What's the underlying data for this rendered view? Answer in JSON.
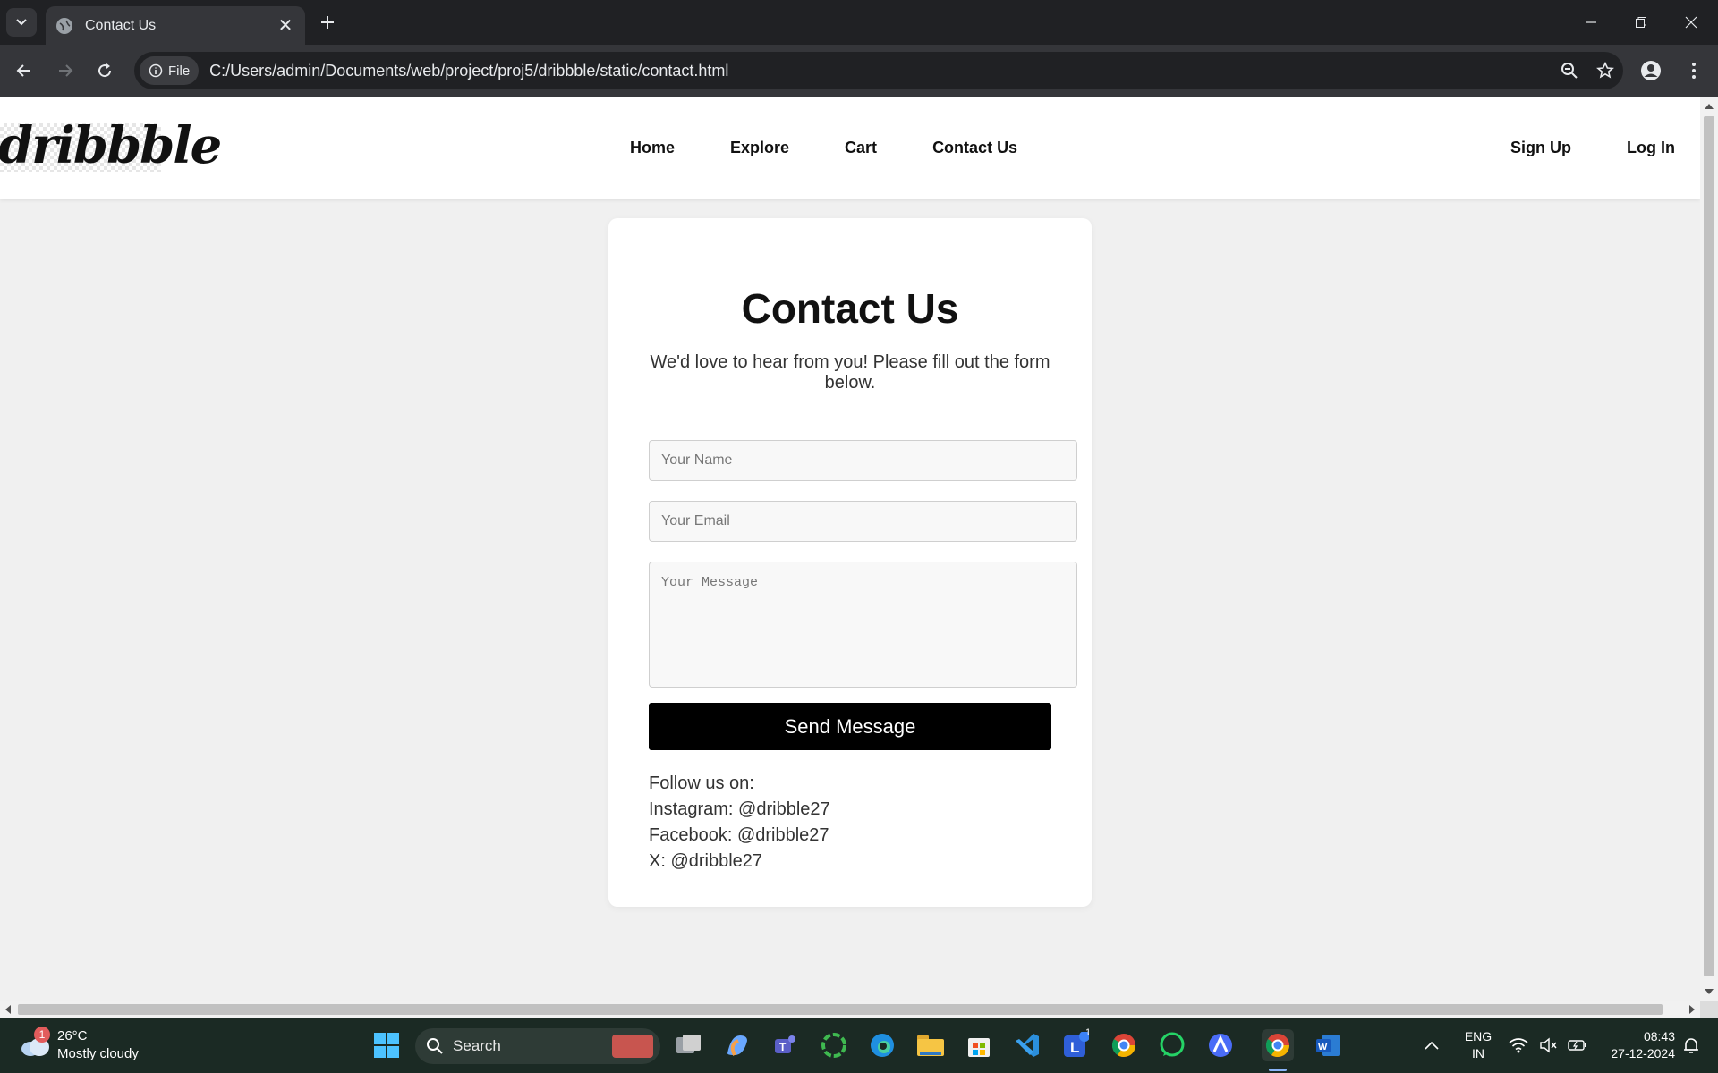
{
  "browser": {
    "tab_title": "Contact Us",
    "file_chip": "File",
    "url": "C:/Users/admin/Documents/web/project/proj5/dribbble/static/contact.html"
  },
  "site": {
    "logo_text": "dribbble",
    "nav": [
      "Home",
      "Explore",
      "Cart",
      "Contact Us"
    ],
    "auth": [
      "Sign Up",
      "Log In"
    ]
  },
  "contact": {
    "heading": "Contact Us",
    "intro": "We'd love to hear from you! Please fill out the form below.",
    "name_placeholder": "Your Name",
    "email_placeholder": "Your Email",
    "message_placeholder": "Your Message",
    "send_label": "Send Message",
    "follow_label": "Follow us on:",
    "socials": [
      "Instagram: @dribble27",
      "Facebook: @dribble27",
      "X: @dribble27"
    ]
  },
  "taskbar": {
    "weather_badge": "1",
    "temperature": "26°C",
    "condition": "Mostly cloudy",
    "search_label": "Search",
    "lang_line1": "ENG",
    "lang_line2": "IN",
    "time": "08:43",
    "date": "27-12-2024",
    "app_badge": "1"
  },
  "icons": {
    "tab_search": "chevron-down-icon",
    "favicon": "globe-icon",
    "close": "close-icon",
    "new_tab": "plus-icon",
    "back": "back-arrow-icon",
    "forward": "forward-arrow-icon",
    "reload": "reload-icon",
    "zoom": "zoom-icon",
    "bookmark": "star-icon",
    "profile": "profile-icon",
    "menu": "kebab-menu-icon"
  },
  "colors": {
    "page_bg": "#f0f0f0",
    "button_bg": "#000000",
    "chrome_bg": "#202124"
  }
}
